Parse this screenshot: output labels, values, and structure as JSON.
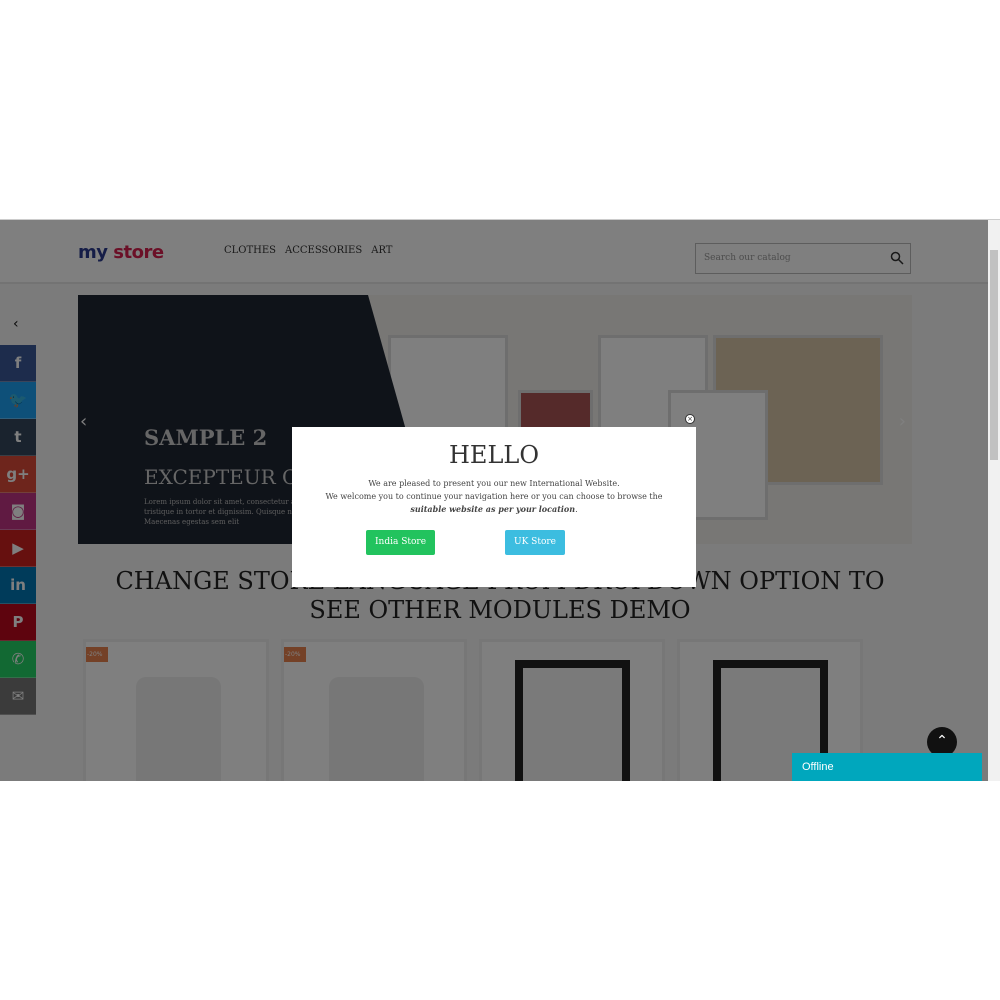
{
  "header": {
    "logo": "my store",
    "nav": [
      "CLOTHES",
      "ACCESSORIES",
      "ART"
    ],
    "search_placeholder": "Search our catalog"
  },
  "slider": {
    "title": "SAMPLE 2",
    "subtitle": "EXCEPTEUR OCCAECAT",
    "text": "Lorem ipsum dolor sit amet, consectetur adipiscing elit. Proin tristique in tortor et dignissim. Quisque non tempor leo. Maecenas egestas sem elit"
  },
  "heading": "CHANGE STORE LANGUAGE FROM DROPDOWN OPTION TO SEE OTHER MODULES DEMO",
  "products": [
    {
      "badge": "-20%"
    },
    {
      "badge": "-20%"
    },
    {
      "badge": ""
    },
    {
      "badge": ""
    }
  ],
  "social": [
    {
      "name": "facebook",
      "glyph": "f",
      "color": "#3b5998"
    },
    {
      "name": "twitter",
      "glyph": "🐦",
      "color": "#1da1f2"
    },
    {
      "name": "tumblr",
      "glyph": "t",
      "color": "#35465c"
    },
    {
      "name": "google-plus",
      "glyph": "g+",
      "color": "#dd4b39"
    },
    {
      "name": "instagram",
      "glyph": "◙",
      "color": "#c13584"
    },
    {
      "name": "youtube",
      "glyph": "▶",
      "color": "#cd201f"
    },
    {
      "name": "linkedin",
      "glyph": "in",
      "color": "#0077b5"
    },
    {
      "name": "pinterest",
      "glyph": "P",
      "color": "#bd081c"
    },
    {
      "name": "whatsapp",
      "glyph": "✆",
      "color": "#25d366"
    },
    {
      "name": "email",
      "glyph": "✉",
      "color": "#777777"
    }
  ],
  "modal": {
    "title": "HELLO",
    "line1": "We are pleased to present you our new International Website.",
    "line2": "We welcome you to continue your navigation here or you can choose to browse the",
    "line3": "suitable website as per your location",
    "india": "India Store",
    "uk": "UK Store",
    "india_color": "#22c35e",
    "uk_color": "#3cbde0"
  },
  "chat": {
    "status": "Offline"
  }
}
